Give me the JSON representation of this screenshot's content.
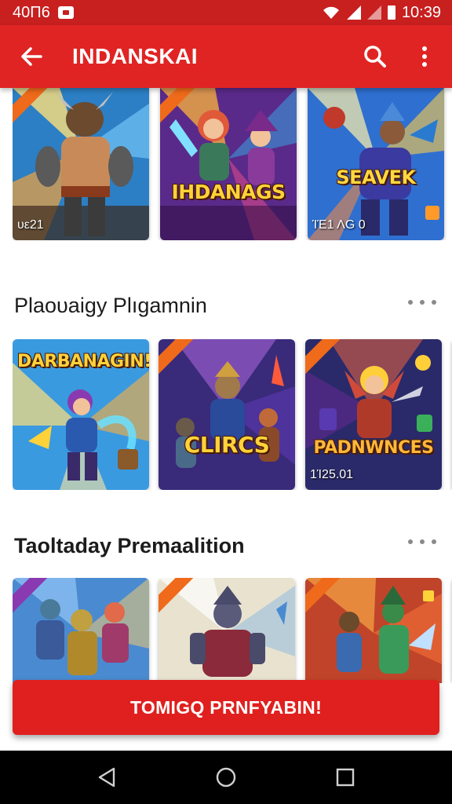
{
  "status_bar": {
    "left_text": "40Π6",
    "time": "10:39"
  },
  "app_bar": {
    "title": "INDANSKAI",
    "icons": [
      "back-arrow-icon",
      "search-icon",
      "more-vert-icon"
    ]
  },
  "carousel_1": {
    "cards": [
      {
        "title": "",
        "subtitle": "υε21"
      },
      {
        "title": "IHDANAGS",
        "subtitle": ""
      },
      {
        "title": "SEAVEK",
        "subtitle": "ΊΈ1 ΛG 0"
      }
    ]
  },
  "section_1": {
    "title": "Plaoυaigy Plıgamnin"
  },
  "carousel_2": {
    "cards": [
      {
        "title": "DARBANAGIN!",
        "subtitle": ""
      },
      {
        "title": "CLIRCS",
        "subtitle": ""
      },
      {
        "title": "PADNWNCES",
        "subtitle": "1Ί25.01"
      }
    ]
  },
  "section_2": {
    "title": "Taoltaday Premaalition"
  },
  "carousel_3": {
    "cards": [
      {
        "title": "",
        "subtitle": ""
      },
      {
        "title": "",
        "subtitle": ""
      },
      {
        "title": "",
        "subtitle": ""
      }
    ]
  },
  "cta": {
    "label": "TOMIGQ PRNFYABIN!"
  },
  "nav_bar": {
    "icons": [
      "nav-back-icon",
      "nav-home-icon",
      "nav-recents-icon"
    ]
  },
  "colors": {
    "primary": "#e02424",
    "status_bar": "#c81f1f",
    "accent_gold": "#ffd23a"
  }
}
